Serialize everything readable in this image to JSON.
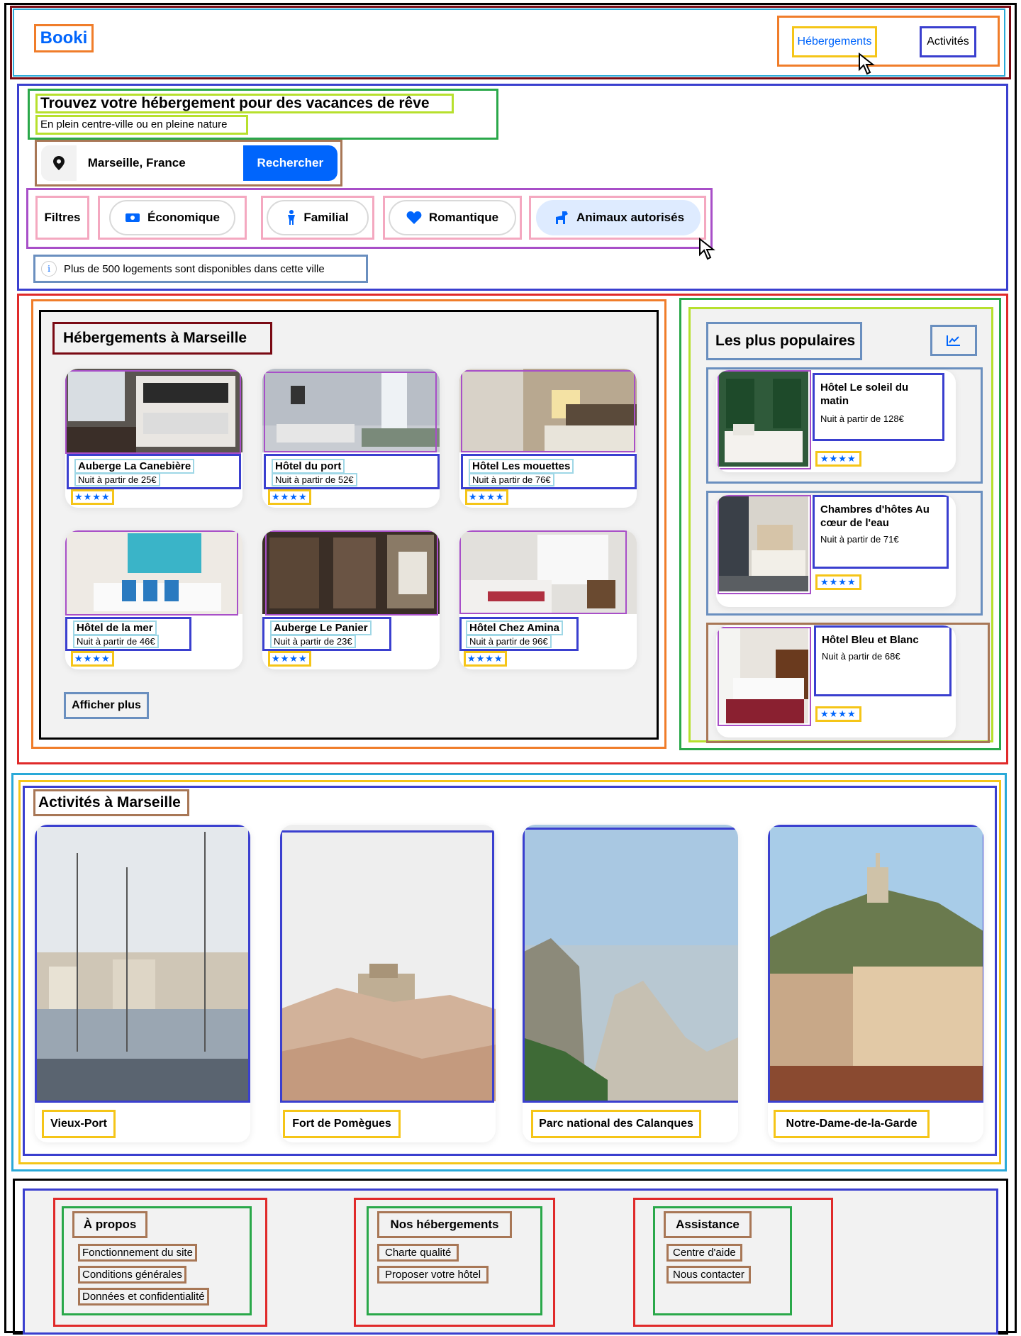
{
  "header": {
    "logo": "Booki",
    "nav": {
      "stays": "Hébergements",
      "activities": "Activités"
    },
    "accent": "#0065FC"
  },
  "hero": {
    "title": "Trouvez votre hébergement pour des vacances de rêve",
    "subtitle": "En plein centre-ville ou en pleine nature",
    "search": {
      "value": "Marseille, France",
      "button": "Rechercher",
      "icon": "location-pin-icon"
    }
  },
  "filters": {
    "label": "Filtres",
    "items": [
      {
        "label": "Économique",
        "icon": "money-icon",
        "active": false
      },
      {
        "label": "Familial",
        "icon": "child-icon",
        "active": false
      },
      {
        "label": "Romantique",
        "icon": "heart-icon",
        "active": false
      },
      {
        "label": "Animaux autorisés",
        "icon": "dog-icon",
        "active": true
      }
    ],
    "info": "Plus de 500 logements sont disponibles dans cette ville"
  },
  "stays": {
    "title": "Hébergements à Marseille",
    "items": [
      {
        "name": "Auberge La Canebière",
        "price": "Nuit à partir de 25€",
        "stars": "★★★★"
      },
      {
        "name": "Hôtel du port",
        "price": "Nuit à partir de 52€",
        "stars": "★★★★"
      },
      {
        "name": "Hôtel Les mouettes",
        "price": "Nuit à partir de 76€",
        "stars": "★★★★"
      },
      {
        "name": "Hôtel de la mer",
        "price": "Nuit à partir de 46€",
        "stars": "★★★★"
      },
      {
        "name": "Auberge Le Panier",
        "price": "Nuit à partir de 23€",
        "stars": "★★★★"
      },
      {
        "name": "Hôtel Chez Amina",
        "price": "Nuit à partir de 96€",
        "stars": "★★★★"
      }
    ],
    "more": "Afficher plus"
  },
  "popular": {
    "title": "Les plus populaires",
    "icon": "trend-chart-icon",
    "items": [
      {
        "name": "Hôtel Le soleil du matin",
        "price": "Nuit à partir de 128€",
        "stars": "★★★★"
      },
      {
        "name": "Chambres d'hôtes Au cœur de l'eau",
        "price": "Nuit à partir de 71€",
        "stars": "★★★★"
      },
      {
        "name": "Hôtel Bleu et Blanc",
        "price": "Nuit à partir de 68€",
        "stars": "★★★★"
      }
    ]
  },
  "activities": {
    "title": "Activités à Marseille",
    "items": [
      {
        "name": "Vieux-Port"
      },
      {
        "name": "Fort de Pomègues"
      },
      {
        "name": "Parc national des Calanques"
      },
      {
        "name": "Notre-Dame-de-la-Garde"
      }
    ]
  },
  "footer": {
    "columns": [
      {
        "title": "À propos",
        "links": [
          "Fonctionnement du site",
          "Conditions générales",
          "Données et confidentialité"
        ]
      },
      {
        "title": "Nos hébergements",
        "links": [
          "Charte qualité",
          "Proposer votre hôtel"
        ]
      },
      {
        "title": "Assistance",
        "links": [
          "Centre d'aide",
          "Nous contacter"
        ]
      }
    ]
  }
}
